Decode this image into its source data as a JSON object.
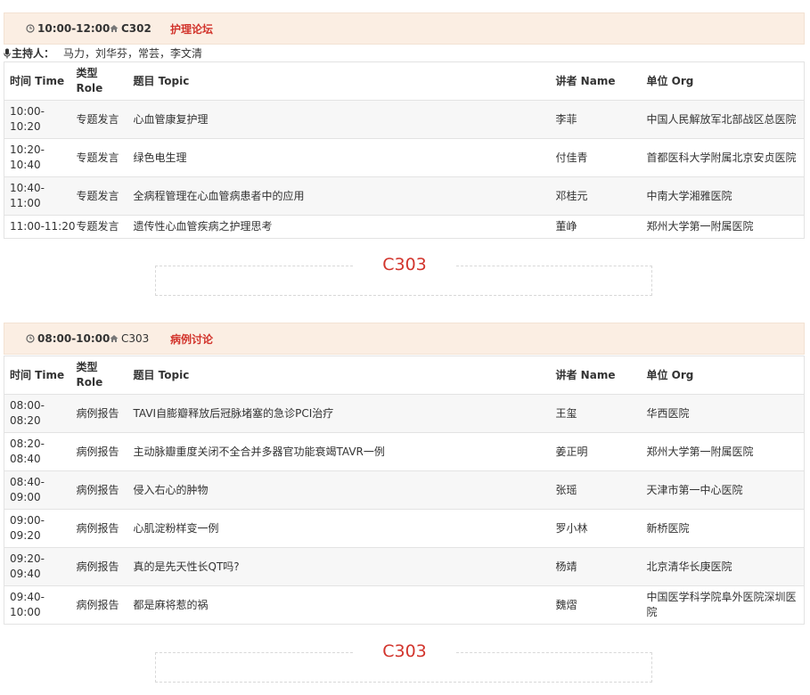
{
  "session1": {
    "time": "10:00-12:00",
    "room": "C302",
    "title": "护理论坛",
    "moderator_label": "主持人：",
    "moderator_names": "马力，刘华芬，常芸，李文清",
    "headers": {
      "time": "时间 Time",
      "role": "类型 Role",
      "topic": "题目 Topic",
      "name": "讲者 Name",
      "org": "单位 Org"
    },
    "rows": [
      {
        "time": "10:00-10:20",
        "role": "专题发言",
        "topic": "心血管康复护理",
        "name": "李菲",
        "org": "中国人民解放军北部战区总医院"
      },
      {
        "time": "10:20-10:40",
        "role": "专题发言",
        "topic": "绿色电生理",
        "name": "付佳青",
        "org": "首都医科大学附属北京安贞医院"
      },
      {
        "time": "10:40-11:00",
        "role": "专题发言",
        "topic": "全病程管理在心血管病患者中的应用",
        "name": "邓桂元",
        "org": "中南大学湘雅医院"
      },
      {
        "time": "11:00-11:20",
        "role": "专题发言",
        "topic": "遗传性心血管疾病之护理思考",
        "name": "董峥",
        "org": "郑州大学第一附属医院"
      }
    ]
  },
  "divider1": {
    "label": "C303"
  },
  "session2": {
    "time": "08:00-10:00",
    "room": "C303",
    "title": "病例讨论",
    "headers": {
      "time": "时间 Time",
      "role": "类型 Role",
      "topic": "题目 Topic",
      "name": "讲者 Name",
      "org": "单位 Org"
    },
    "rows": [
      {
        "time": "08:00-08:20",
        "role": "病例报告",
        "topic": "TAVI自膨瓣释放后冠脉堵塞的急诊PCI治疗",
        "name": "王玺",
        "org": "华西医院"
      },
      {
        "time": "08:20-08:40",
        "role": "病例报告",
        "topic": "主动脉瓣重度关闭不全合并多器官功能衰竭TAVR一例",
        "name": "姜正明",
        "org": "郑州大学第一附属医院"
      },
      {
        "time": "08:40-09:00",
        "role": "病例报告",
        "topic": "侵入右心的肿物",
        "name": "张瑶",
        "org": "天津市第一中心医院"
      },
      {
        "time": "09:00-09:20",
        "role": "病例报告",
        "topic": "心肌淀粉样变一例",
        "name": "罗小林",
        "org": "新桥医院"
      },
      {
        "time": "09:20-09:40",
        "role": "病例报告",
        "topic": "真的是先天性长QT吗?",
        "name": "杨靖",
        "org": "北京清华长庚医院"
      },
      {
        "time": "09:40-10:00",
        "role": "病例报告",
        "topic": "都是麻将惹的祸",
        "name": "魏熠",
        "org": "中国医学科学院阜外医院深圳医院"
      }
    ]
  },
  "divider2": {
    "label": "C303"
  }
}
